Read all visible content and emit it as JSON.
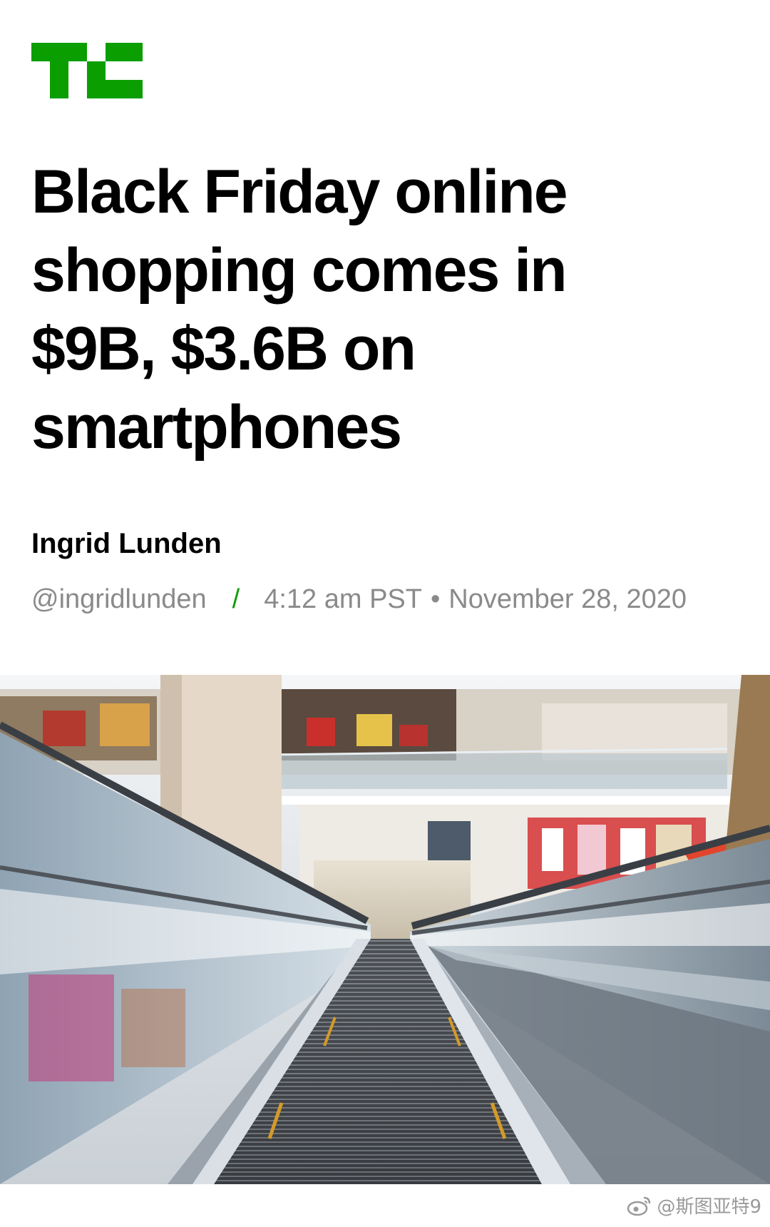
{
  "brand": {
    "logo": "techcrunch-tc-logo",
    "accent_color": "#0a9e01"
  },
  "article": {
    "headline": "Black Friday online shopping comes in $9B, $3.6B on smartphones",
    "author": "Ingrid Lunden",
    "handle": "@ingridlunden",
    "separator": "/",
    "time": "4:12 am PST",
    "dot": "•",
    "date": "November 28, 2020"
  },
  "hero_image": {
    "subject": "shopping-mall-escalator-photo"
  },
  "watermark": {
    "icon": "weibo-icon",
    "text": "@斯图亚特9"
  }
}
